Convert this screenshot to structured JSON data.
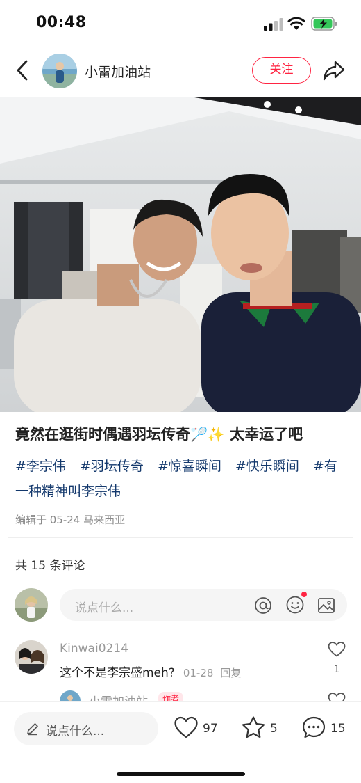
{
  "status_bar": {
    "time": "00:48"
  },
  "header": {
    "author_name": "小雷加油站",
    "follow_label": "关注",
    "icons": [
      "back-icon",
      "share-icon"
    ]
  },
  "post": {
    "title_text": "竟然在逛街时偶遇羽坛传奇",
    "title_emoji": "🏸✨",
    "title_tail": "太幸运了吧",
    "hashtags": [
      "#李宗伟",
      "#羽坛传奇",
      "#惊喜瞬间",
      "#快乐瞬间",
      "#有一种精神叫李宗伟"
    ],
    "meta": "编辑于 05-24 马来西亚"
  },
  "comments_section": {
    "count_label": "共 15 条评论",
    "input_placeholder": "说点什么...",
    "input_icons": [
      "at-icon",
      "emoji-icon",
      "image-icon"
    ]
  },
  "comments": [
    {
      "username": "Kinwai0214",
      "text": "这个不是李宗盛meh?",
      "date": "01-28",
      "reply_label": "回复",
      "likes": "1"
    }
  ],
  "reply_preview": {
    "username": "小雷加油站",
    "badge": "作者"
  },
  "bottom_bar": {
    "input_placeholder": "说点什么...",
    "likes": "97",
    "stars": "5",
    "comments": "15"
  },
  "colors": {
    "accent": "#ff2442",
    "hashtag": "#13386c",
    "muted": "#999999"
  }
}
